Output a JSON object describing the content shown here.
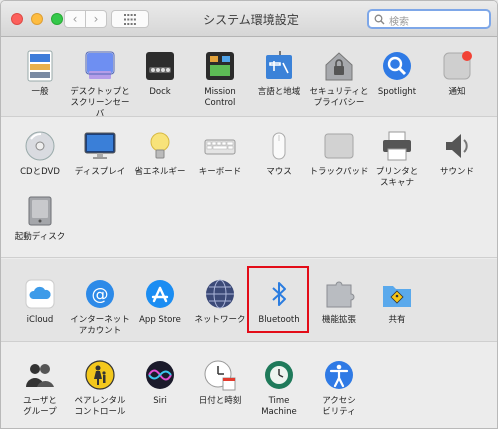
{
  "window": {
    "title": "システム環境設定"
  },
  "toolbar": {
    "back_label": "‹",
    "forward_label": "›"
  },
  "search": {
    "placeholder": "検索"
  },
  "sections": [
    {
      "items": [
        {
          "id": "general",
          "label": "一般",
          "icon": "general-icon"
        },
        {
          "id": "desktop",
          "label": "デスクトップと\nスクリーンセーバ",
          "icon": "desktop-screensaver-icon"
        },
        {
          "id": "dock",
          "label": "Dock",
          "icon": "dock-icon"
        },
        {
          "id": "mission",
          "label": "Mission\nControl",
          "icon": "mission-control-icon"
        },
        {
          "id": "language",
          "label": "言語と地域",
          "icon": "language-region-icon"
        },
        {
          "id": "security",
          "label": "セキュリティと\nプライバシー",
          "icon": "security-privacy-icon"
        },
        {
          "id": "spotlight",
          "label": "Spotlight",
          "icon": "spotlight-icon"
        },
        {
          "id": "notifications",
          "label": "通知",
          "icon": "notifications-icon"
        }
      ]
    },
    {
      "items": [
        {
          "id": "cd",
          "label": "CDとDVD",
          "icon": "cd-dvd-icon"
        },
        {
          "id": "displays",
          "label": "ディスプレイ",
          "icon": "displays-icon"
        },
        {
          "id": "energy",
          "label": "省エネルギー",
          "icon": "energy-saver-icon"
        },
        {
          "id": "keyboard",
          "label": "キーボード",
          "icon": "keyboard-icon"
        },
        {
          "id": "mouse",
          "label": "マウス",
          "icon": "mouse-icon"
        },
        {
          "id": "trackpad",
          "label": "トラックパッド",
          "icon": "trackpad-icon"
        },
        {
          "id": "printers",
          "label": "プリンタと\nスキャナ",
          "icon": "printer-icon"
        },
        {
          "id": "sound",
          "label": "サウンド",
          "icon": "sound-icon"
        },
        {
          "id": "startup",
          "label": "起動ディスク",
          "icon": "startup-disk-icon"
        }
      ]
    },
    {
      "items": [
        {
          "id": "icloud",
          "label": "iCloud",
          "icon": "icloud-icon"
        },
        {
          "id": "internet",
          "label": "インターネット\nアカウント",
          "icon": "internet-accounts-icon"
        },
        {
          "id": "appstore",
          "label": "App Store",
          "icon": "app-store-icon"
        },
        {
          "id": "network",
          "label": "ネットワーク",
          "icon": "network-icon"
        },
        {
          "id": "bluetooth",
          "label": "Bluetooth",
          "icon": "bluetooth-icon"
        },
        {
          "id": "extensions",
          "label": "機能拡張",
          "icon": "extensions-icon"
        },
        {
          "id": "sharing",
          "label": "共有",
          "icon": "sharing-icon"
        }
      ]
    },
    {
      "items": [
        {
          "id": "users",
          "label": "ユーザと\nグループ",
          "icon": "users-groups-icon"
        },
        {
          "id": "parental",
          "label": "ペアレンタル\nコントロール",
          "icon": "parental-controls-icon"
        },
        {
          "id": "siri",
          "label": "Siri",
          "icon": "siri-icon"
        },
        {
          "id": "datetime",
          "label": "日付と時刻",
          "icon": "date-time-icon"
        },
        {
          "id": "timemachine",
          "label": "Time\nMachine",
          "icon": "time-machine-icon"
        },
        {
          "id": "accessibility",
          "label": "アクセシ\nビリティ",
          "icon": "accessibility-icon"
        }
      ]
    }
  ],
  "highlight": {
    "item": "bluetooth",
    "color": "#e30c18"
  },
  "colors": {
    "accent": "#3478f6"
  }
}
